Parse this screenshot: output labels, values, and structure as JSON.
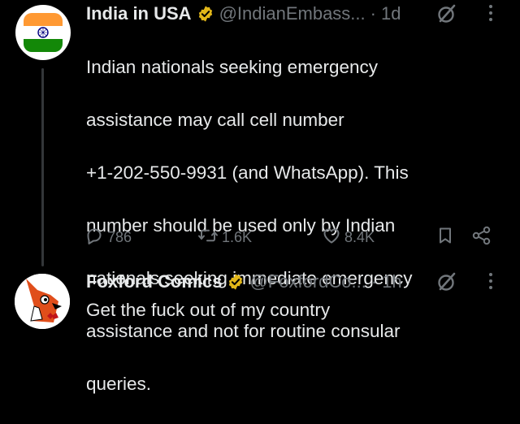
{
  "tweet": {
    "author_name": "India in USA",
    "handle": "@IndianEmbass...",
    "separator": "·",
    "time": "1d",
    "text_lines": [
      "Indian nationals seeking emergency",
      "assistance may call cell number",
      "+1-202-550-9931 (and WhatsApp). This",
      "number should be used only by Indian",
      "nationals seeking immediate emergency",
      "assistance and not for routine consular",
      "queries."
    ],
    "actions": {
      "replies": "786",
      "reposts": "1.6K",
      "likes": "8.4K"
    }
  },
  "reply": {
    "author_name": "Foxford Comics",
    "handle": "@FoxfordCo...",
    "separator": "·",
    "time": "1h",
    "text": "Get the fuck out of my country"
  },
  "icons": {
    "verified": "verified-badge-icon",
    "grok": "grok-icon",
    "more": "more-vertical-icon",
    "reply": "reply-icon",
    "repost": "repost-icon",
    "like": "heart-icon",
    "bookmark": "bookmark-icon",
    "share": "share-icon"
  },
  "colors": {
    "background": "#000000",
    "text_primary": "#e7e9ea",
    "text_secondary": "#71767b",
    "verified_gold": "#e2b719",
    "thread_line": "#333639",
    "saffron": "#ff9933",
    "india_green": "#138808",
    "chakra_blue": "#000080"
  }
}
